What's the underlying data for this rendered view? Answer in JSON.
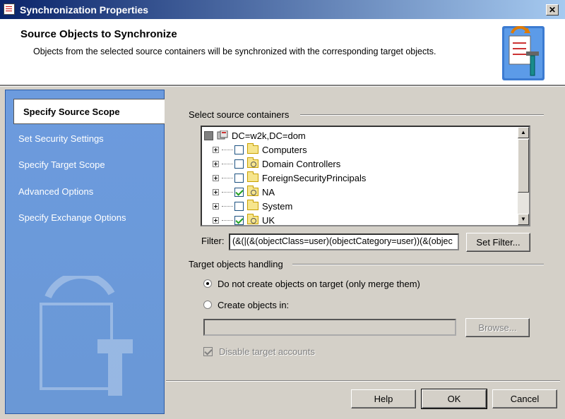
{
  "window": {
    "title": "Synchronization Properties",
    "close_label": "✕"
  },
  "header": {
    "title": "Source Objects to Synchronize",
    "description": "Objects from the selected source containers will be synchronized with the corresponding target objects."
  },
  "sidebar": {
    "items": [
      {
        "label": "Specify Source Scope",
        "active": true
      },
      {
        "label": "Set Security Settings"
      },
      {
        "label": "Specify Target Scope"
      },
      {
        "label": "Advanced Options"
      },
      {
        "label": "Specify Exchange Options"
      }
    ]
  },
  "source_containers": {
    "group_label": "Select source containers",
    "root": {
      "label": "DC=w2k,DC=dom"
    },
    "items": [
      {
        "label": "Computers",
        "checked": false
      },
      {
        "label": "Domain Controllers",
        "checked": false
      },
      {
        "label": "ForeignSecurityPrincipals",
        "checked": false
      },
      {
        "label": "NA",
        "checked": true
      },
      {
        "label": "System",
        "checked": false
      },
      {
        "label": "UK",
        "checked": true
      }
    ]
  },
  "filter": {
    "label": "Filter:",
    "value": "(&(|(&(objectClass=user)(objectCategory=user))(&(objec",
    "set_filter_label": "Set Filter..."
  },
  "target_handling": {
    "group_label": "Target objects handling",
    "option_merge": "Do not create objects on target (only merge them)",
    "option_create": "Create objects in:",
    "browse_label": "Browse...",
    "disable_accounts_label": "Disable target accounts"
  },
  "footer": {
    "help_label": "Help",
    "ok_label": "OK",
    "cancel_label": "Cancel"
  },
  "colors": {
    "title_bar": "#0a246a",
    "sidebar": "#6c9bde",
    "dialog_bg": "#d4d0c8"
  }
}
